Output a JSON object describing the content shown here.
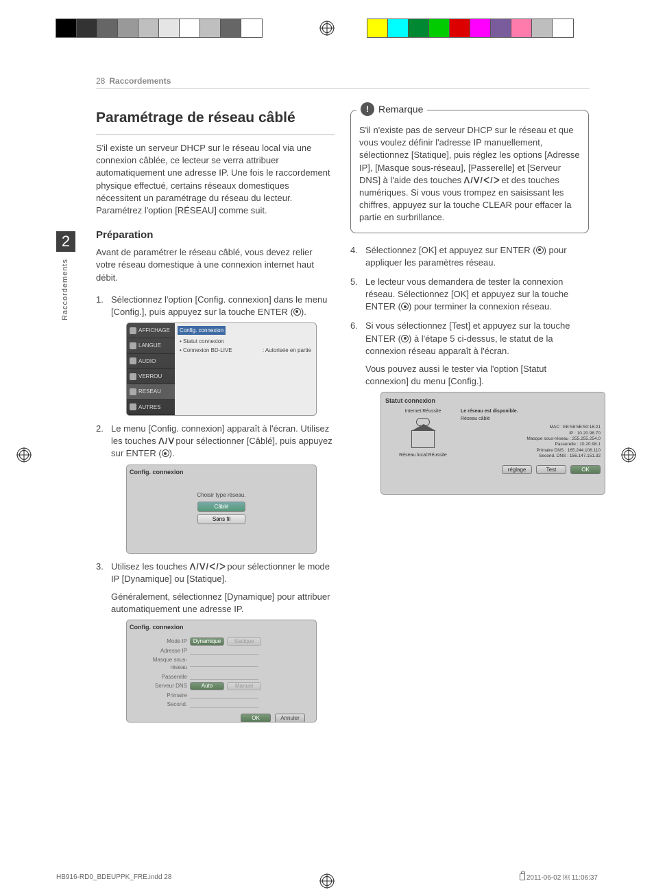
{
  "runhead": {
    "page": "28",
    "section": "Raccordements"
  },
  "sidetab": {
    "number": "2",
    "label": "Raccordements"
  },
  "left": {
    "title": "Paramétrage de réseau câblé",
    "intro": "S'il existe un serveur DHCP sur le réseau local via une connexion câblée, ce lecteur se verra attribuer automatiquement une adresse IP. Une fois le raccordement physique effectué, certains réseaux domestiques nécessitent un paramétrage du réseau du lecteur. Paramétrez l'option [RÉSEAU] comme suit.",
    "prep_heading": "Préparation",
    "prep_body": "Avant de paramétrer le réseau câblé, vous devez relier votre réseau domestique à une connexion internet haut débit.",
    "step1": "Sélectionnez l'option [Config. connexion] dans le menu [Config.], puis appuyez sur la touche ENTER (",
    "step1_end": ").",
    "step2a": "Le menu [Config. connexion] apparaît à l'écran. Utilisez les touches ",
    "step2_keys": "ᐱ / ᐯ",
    "step2b": " pour sélectionner [Câblé], puis appuyez sur ENTER (",
    "step2_end": ").",
    "step3a": "Utilisez les touches ",
    "step3_keys": "ᐱ / ᐯ / ᐸ / ᐳ",
    "step3b": " pour sélectionner le mode IP [Dynamique] ou [Statique].",
    "step3c": "Généralement, sélectionnez [Dynamique] pour attribuer automatiquement une adresse IP.",
    "shot1": {
      "sidebar": [
        "AFFICHAGE",
        "LANGUE",
        "AUDIO",
        "VERROU",
        "RESEAU",
        "AUTRES"
      ],
      "main_hl": "Config. connexion",
      "rows": [
        {
          "l": "• Statut connexion",
          "r": ""
        },
        {
          "l": "• Connexion BD-LIVE",
          "r": ": Autorisée en partie"
        }
      ]
    },
    "shot2": {
      "title": "Config. connexion",
      "label": "Choisir type réseau.",
      "opt_sel": "Câblé",
      "opt_other": "Sans fil"
    },
    "shot3": {
      "title": "Config. connexion",
      "rows": {
        "mode_ip": "Mode IP",
        "dyn": "Dynamique",
        "stat": "Statique",
        "adresse": "Adresse IP",
        "masque": "Masque sous-réseau",
        "passerelle": "Passerelle",
        "dns": "Serveur DNS",
        "auto": "Auto",
        "manuel": "Manuel",
        "prim": "Primaire",
        "sec": "Second."
      },
      "ok": "OK",
      "cancel": "Annuler"
    }
  },
  "right": {
    "remark_title": "Remarque",
    "remark_body_a": "S'il n'existe pas de serveur DHCP sur le réseau et que vous voulez définir l'adresse IP manuellement, sélectionnez [Statique], puis réglez les options [Adresse IP], [Masque sous-réseau], [Passerelle] et [Serveur DNS] à l'aide des touches ",
    "remark_keys": "ᐱ / ᐯ / ᐸ / ᐳ",
    "remark_body_b": " et des touches numériques. Si vous vous trompez en saisissant les chiffres, appuyez sur la touche CLEAR pour effacer la partie en surbrillance.",
    "step4": "Sélectionnez [OK] et appuyez sur ENTER (",
    "step4_end": ") pour appliquer les paramètres réseau.",
    "step5": "Le lecteur vous demandera de tester la connexion réseau. Sélectionnez [OK] et appuyez sur la touche ENTER (",
    "step5_end": ") pour terminer la connexion réseau.",
    "step6": "Si vous sélectionnez [Test] et appuyez sur la touche ENTER (",
    "step6_mid": ") à l'étape 5 ci-dessus, le statut de la connexion réseau apparaît à l'écran.",
    "step6b": "Vous pouvez aussi le tester via l'option [Statut connexion] du menu [Config.].",
    "shot4": {
      "title": "Statut connexion",
      "diag_top": "Internet:Réussite",
      "diag_bottom": "Réseau local:Réussite",
      "hdr": "Le réseau est disponible.",
      "sub": "Réseau câblé",
      "info": [
        "MAC : EE:58:5B:50:16:21",
        "IP : 10.20.98.70",
        "Masque sous-réseau : 255.255.254.0",
        "Passerelle : 10.20.98.1",
        "Primaire DNS : 165.244.106.110",
        "Second. DNS : 156.147.151.32"
      ],
      "b1": "réglage",
      "b2": "Test",
      "b3": "OK"
    }
  },
  "footer": {
    "file": "HB916-RD0_BDEUPPK_FRE.indd   28",
    "date": "2011-06-02   ￼ 11:06:37"
  }
}
